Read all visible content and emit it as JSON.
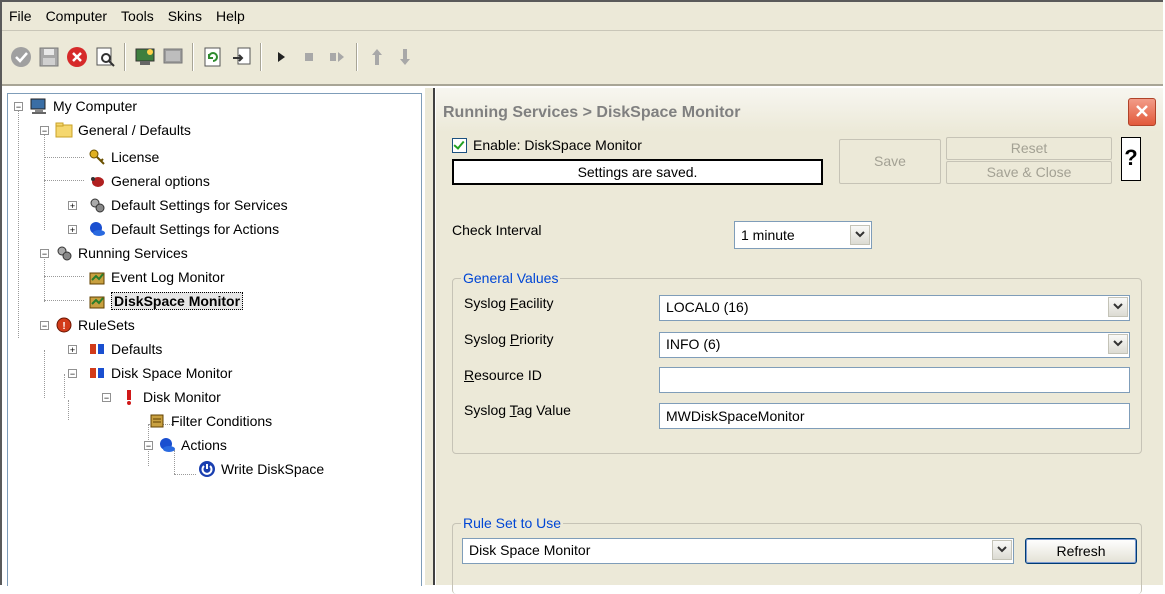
{
  "menu": {
    "items": [
      {
        "label": "File"
      },
      {
        "label": "Computer"
      },
      {
        "label": "Tools"
      },
      {
        "label": "Skins"
      },
      {
        "label": "Help"
      }
    ]
  },
  "toolbar": {
    "buttons": [
      "confirm-icon",
      "save-icon",
      "cancel-icon",
      "find-icon",
      "service-icon",
      "monitor-icon",
      "refresh-icon",
      "export-icon",
      "play-icon",
      "stop-icon",
      "step-icon",
      "up-arrow-icon",
      "down-arrow-icon"
    ]
  },
  "tree": {
    "root": "My Computer",
    "general": "General / Defaults",
    "license": "License",
    "general_options": "General options",
    "default_services": "Default Settings for Services",
    "default_actions": "Default Settings for Actions",
    "running_services": "Running Services",
    "event_log_monitor": "Event Log Monitor",
    "diskspace_monitor": "DiskSpace Monitor",
    "rulesets": "RuleSets",
    "defaults": "Defaults",
    "disk_space_monitor": "Disk Space Monitor",
    "disk_monitor": "Disk Monitor",
    "filter_conditions": "Filter Conditions",
    "actions": "Actions",
    "write_diskspace": "Write DiskSpace"
  },
  "panel": {
    "title": "Running Services > DiskSpace Monitor",
    "enable_label": "Enable: DiskSpace Monitor",
    "status": "Settings are saved.",
    "save_label": "Save",
    "reset_label": "Reset",
    "save_close_label": "Save & Close",
    "help_label": "?",
    "check_interval_label": "Check Interval",
    "check_interval_value": "1 minute",
    "general_values_title": "General Values",
    "syslog_facility_label": "Syslog Facility",
    "syslog_facility_value": "LOCAL0 (16)",
    "syslog_priority_label": "Syslog Priority",
    "syslog_priority_value": "INFO (6)",
    "resource_id_label": "Resource ID",
    "resource_id_value": "",
    "syslog_tag_label": "Syslog Tag Value",
    "syslog_tag_value": "MWDiskSpaceMonitor",
    "rule_set_title": "Rule Set to Use",
    "rule_set_value": "Disk Space Monitor",
    "refresh_label": "Refresh"
  },
  "colors": {
    "chrome": "#ece9d8",
    "group_title": "#0046d5",
    "close_button": "#e2593b"
  }
}
